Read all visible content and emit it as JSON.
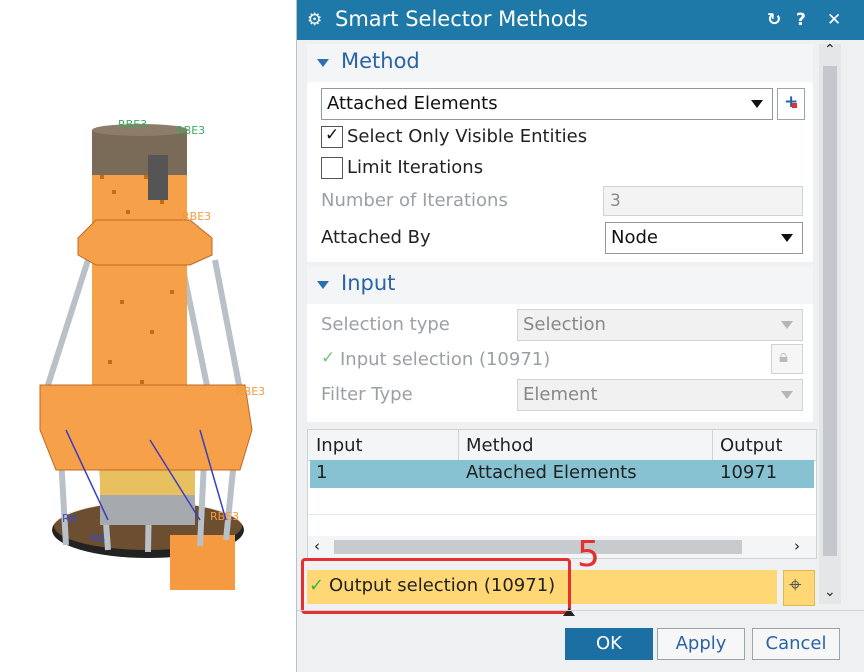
{
  "dialog": {
    "title": "Smart Selector Methods",
    "method_section": {
      "title": "Method",
      "method_value": "Attached Elements",
      "select_visible_label": "Select Only Visible Entities",
      "select_visible_checked": true,
      "limit_iterations_label": "Limit Iterations",
      "limit_iterations_checked": false,
      "num_iterations_label": "Number of Iterations",
      "num_iterations_value": "3",
      "attached_by_label": "Attached By",
      "attached_by_value": "Node"
    },
    "input_section": {
      "title": "Input",
      "selection_type_label": "Selection type",
      "selection_type_value": "Selection",
      "input_selection_label": "Input selection (10971)",
      "filter_type_label": "Filter Type",
      "filter_type_value": "Element"
    },
    "table": {
      "columns": [
        "Input",
        "Method",
        "Output"
      ],
      "rows": [
        {
          "input": "1",
          "method": "Attached Elements",
          "output": "10971"
        }
      ]
    },
    "output_selection_label": "Output selection (10971)",
    "annotation_number": "5",
    "buttons": {
      "ok": "OK",
      "apply": "Apply",
      "cancel": "Cancel"
    }
  },
  "colors": {
    "titlebar": "#1e78a8",
    "section_title": "#2a64a8",
    "selected_row": "#87c2d3",
    "output_highlight": "#ffd875",
    "annotation_red": "#e53030",
    "model_orange": "#f7a04a"
  }
}
